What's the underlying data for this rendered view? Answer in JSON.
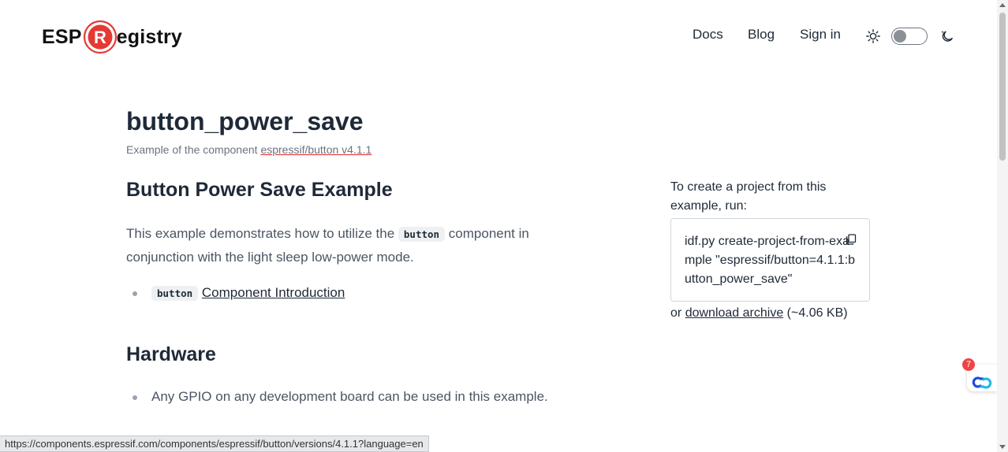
{
  "header": {
    "logo": {
      "text_left": "ESP",
      "letter": "R",
      "text_right": "egistry"
    },
    "nav": {
      "docs": "Docs",
      "blog": "Blog",
      "sign_in": "Sign in"
    },
    "theme": {
      "light_icon": "sun-icon",
      "dark_icon": "moon-icon",
      "toggle_on": false
    }
  },
  "main": {
    "title": "button_power_save",
    "subtitle_prefix": "Example of the component",
    "component_link": "espressif/button v4.1.1",
    "section1": {
      "heading": "Button Power Save Example",
      "para_before": "This example demonstrates how to utilize the",
      "para_code": "button",
      "para_after": "component in conjunction with the light sleep low-power mode.",
      "list_item_code": "button",
      "list_item_link": "Component Introduction"
    },
    "section2": {
      "heading": "Hardware",
      "list_item": "Any GPIO on any development board can be used in this example."
    }
  },
  "aside": {
    "intro": "To create a project from this example, run:",
    "command": "idf.py create-project-from-example \"espressif/button=4.1.1:button_power_save\"",
    "download_prefix": "or",
    "download_link": "download archive",
    "download_size": "(~4.06 KB)"
  },
  "widget": {
    "badge": "7",
    "icon": "chat-link-icon"
  },
  "status_bar": {
    "url": "https://components.espressif.com/components/espressif/button/versions/4.1.1?language=en"
  },
  "colors": {
    "brand": "#e53935",
    "text": "#1f2937",
    "muted": "#6b7280",
    "badge": "#ef4444"
  }
}
